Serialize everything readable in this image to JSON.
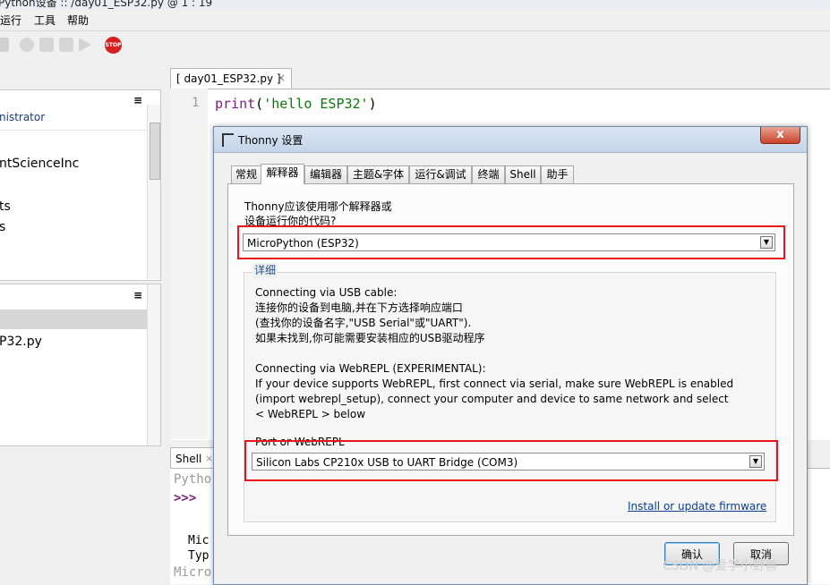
{
  "window": {
    "title": "Python设备 :: /day01_ESP32.py  @  1 : 19"
  },
  "menu": [
    "运行",
    "工具",
    "帮助"
  ],
  "toolbar": {
    "stop_label": "STOP"
  },
  "files_pane": {
    "header_menu": "≡",
    "items": [
      "nistrator",
      "ntScienceInc",
      "ts",
      "s"
    ]
  },
  "device_pane": {
    "header_menu": "≡",
    "items": [
      "P32.py"
    ]
  },
  "editor": {
    "tab_label": "[ day01_ESP32.py ]",
    "tab_close": "×",
    "line_number": "1",
    "code_func": "print",
    "code_paren_open": "(",
    "code_string": "'hello ESP32'",
    "code_paren_close": ")"
  },
  "shell": {
    "tab_label": "Shell",
    "tab_close": "×",
    "line1": "Pytho",
    "prompt": ">>>",
    "line3": "Mic",
    "line4": "Typ",
    "line5": "Micro"
  },
  "dialog": {
    "title": "Thonny 设置",
    "close": "x",
    "tabs": [
      "常规",
      "解释器",
      "编辑器",
      "主题&字体",
      "运行&调试",
      "终端",
      "Shell",
      "助手"
    ],
    "question_line1": "Thonny应该使用哪个解释器或",
    "question_line2": "设备运行你的代码?",
    "interpreter_value": "MicroPython (ESP32)",
    "details_label": "详细",
    "usb_heading": "Connecting via USB cable:",
    "usb_line1": "连接你的设备到电脑,并在下方选择响应端口",
    "usb_line2": "(查找你的设备名字,\"USB Serial\"或\"UART\").",
    "usb_line3": "如果未找到,你可能需要安装相应的USB驱动程序",
    "webrepl_heading": "Connecting via WebREPL (EXPERIMENTAL):",
    "webrepl_line1": "If your device supports WebREPL, first connect via serial, make sure WebREPL is enabled",
    "webrepl_line2": "(import webrepl_setup), connect your computer and device to same network and select",
    "webrepl_line3": "< WebREPL > below",
    "port_label": "Port or WebREPL",
    "port_value": "Silicon Labs CP210x USB to UART Bridge (COM3)",
    "firmware_link": "Install or update firmware",
    "ok_button": "确认",
    "cancel_button": "取消"
  },
  "watermark": "CSDN @爱学小野兽",
  "colors": {
    "highlight_red": "#e5161c",
    "code_func": "#7a1f7a",
    "code_string": "#0a7a0a",
    "link": "#0b3d91",
    "prompt": "#7a1f7a"
  }
}
